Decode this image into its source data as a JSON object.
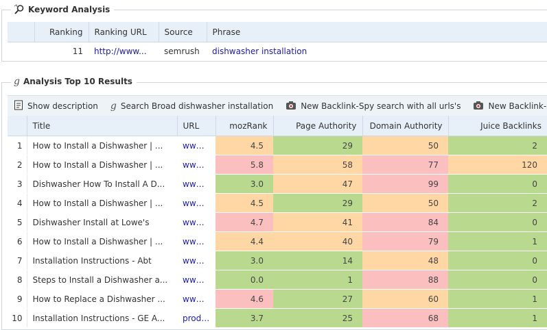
{
  "colors": {
    "green": "#b9d98e",
    "orange": "#fed7a4",
    "red": "#fbbfc0",
    "header_bg": "#e7eff8",
    "link": "#1a1aa6"
  },
  "keyword_section": {
    "title": "Keyword Analysis",
    "icon": "keyword-analysis-icon",
    "columns": [
      "Ranking",
      "Ranking URL",
      "Source",
      "Phrase"
    ],
    "row": {
      "ranking": "11",
      "ranking_url": "http://www...",
      "source": "semrush",
      "phrase": "dishwasher installation"
    }
  },
  "results_section": {
    "title": "Analysis Top 10 Results",
    "icon": "google-g-icon",
    "toolbar": {
      "show_description": "Show description",
      "search_broad": "Search Broad dishwasher installation",
      "backlink_spy_all": "New Backlink-Spy search with all urls's",
      "backlink_spy_next": "New Backlink-S"
    },
    "columns": [
      "Title",
      "URL",
      "mozRank",
      "Page Authority",
      "Domain Authority",
      "Juice Backlinks"
    ],
    "rows": [
      {
        "n": "1",
        "title": "How to Install a Dishwasher | ...",
        "url": "www....",
        "mozrank": "4.5",
        "mozrank_color": "orange",
        "pa": "29",
        "pa_color": "green",
        "da": "50",
        "da_color": "orange",
        "jb": "2",
        "jb_color": "green"
      },
      {
        "n": "2",
        "title": "How to Install a Dishwasher | ...",
        "url": "www....",
        "mozrank": "5.8",
        "mozrank_color": "red",
        "pa": "58",
        "pa_color": "orange",
        "da": "77",
        "da_color": "red",
        "jb": "120",
        "jb_color": "orange"
      },
      {
        "n": "3",
        "title": "Dishwasher How To Install A D...",
        "url": "www....",
        "mozrank": "3.0",
        "mozrank_color": "green",
        "pa": "47",
        "pa_color": "orange",
        "da": "99",
        "da_color": "red",
        "jb": "0",
        "jb_color": "green"
      },
      {
        "n": "4",
        "title": "How to Install a Dishwasher | ...",
        "url": "www....",
        "mozrank": "4.5",
        "mozrank_color": "orange",
        "pa": "29",
        "pa_color": "green",
        "da": "50",
        "da_color": "orange",
        "jb": "2",
        "jb_color": "green"
      },
      {
        "n": "5",
        "title": "Dishwasher Install at Lowe's",
        "url": "www.l...",
        "mozrank": "4.7",
        "mozrank_color": "red",
        "pa": "41",
        "pa_color": "orange",
        "da": "84",
        "da_color": "red",
        "jb": "0",
        "jb_color": "green"
      },
      {
        "n": "6",
        "title": "How to Install a Dishwasher | ...",
        "url": "www....",
        "mozrank": "4.4",
        "mozrank_color": "orange",
        "pa": "40",
        "pa_color": "orange",
        "da": "79",
        "da_color": "red",
        "jb": "1",
        "jb_color": "green"
      },
      {
        "n": "7",
        "title": "Installation Instructions - Abt",
        "url": "www....",
        "mozrank": "3.0",
        "mozrank_color": "green",
        "pa": "14",
        "pa_color": "green",
        "da": "48",
        "da_color": "orange",
        "jb": "0",
        "jb_color": "green"
      },
      {
        "n": "8",
        "title": "Steps to Install a Dishwasher a...",
        "url": "www....",
        "mozrank": "0.0",
        "mozrank_color": "green",
        "pa": "1",
        "pa_color": "green",
        "da": "88",
        "da_color": "red",
        "jb": "0",
        "jb_color": "green"
      },
      {
        "n": "9",
        "title": "How to Replace a Dishwasher ...",
        "url": "www....",
        "mozrank": "4.6",
        "mozrank_color": "red",
        "pa": "27",
        "pa_color": "green",
        "da": "60",
        "da_color": "orange",
        "jb": "1",
        "jb_color": "green"
      },
      {
        "n": "10",
        "title": "Installation Instructions - GE A...",
        "url": "produ...",
        "mozrank": "3.7",
        "mozrank_color": "green",
        "pa": "25",
        "pa_color": "green",
        "da": "68",
        "da_color": "red",
        "jb": "1",
        "jb_color": "green"
      }
    ]
  }
}
